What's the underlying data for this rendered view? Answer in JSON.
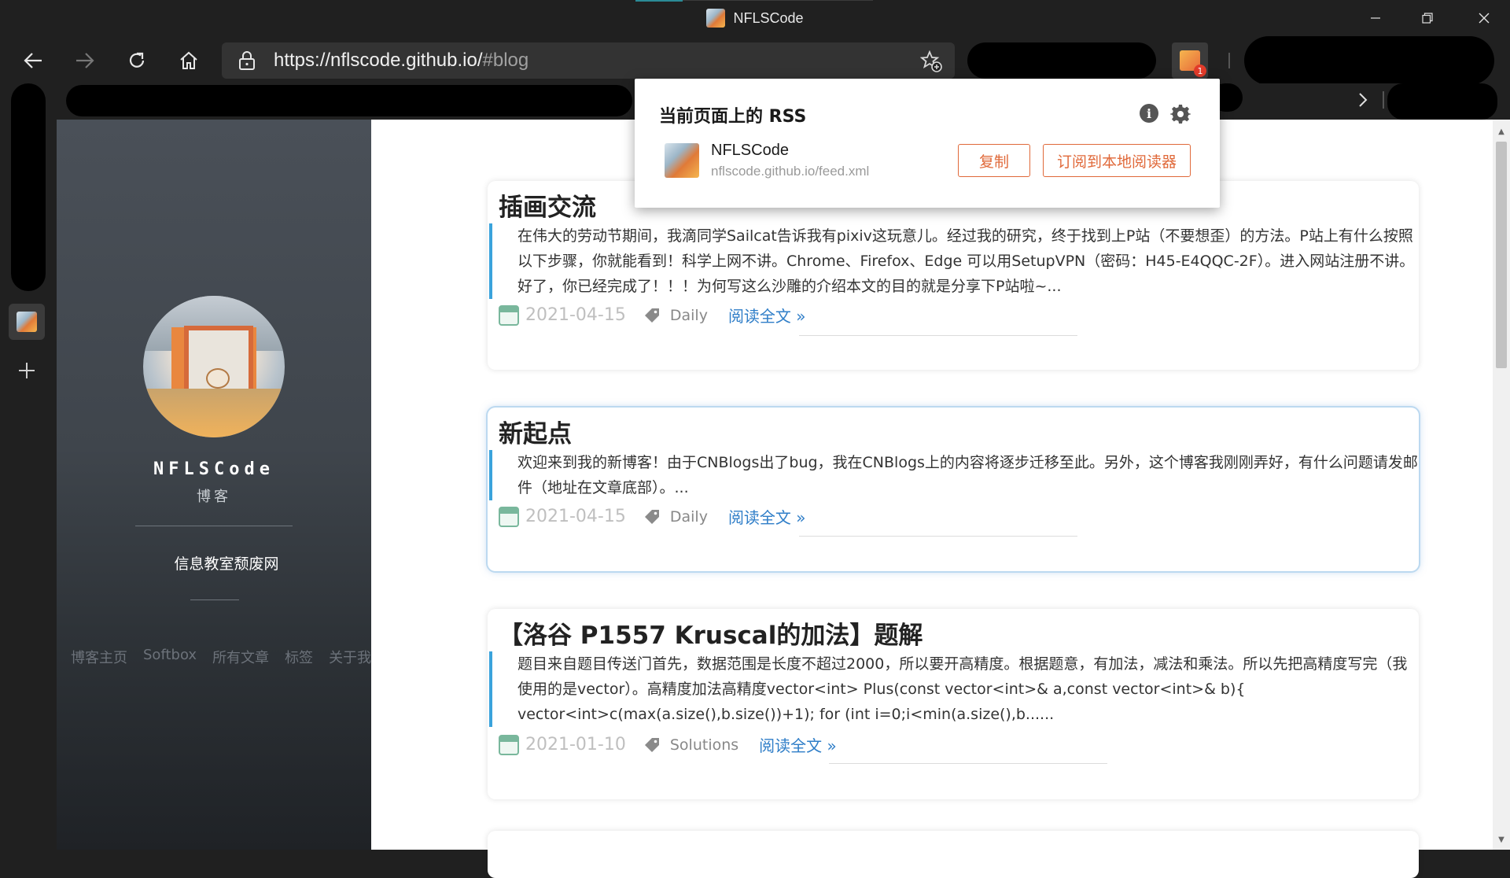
{
  "window": {
    "title": "NFLSCode",
    "minimize_icon": "minimize-icon",
    "maximize_icon": "restore-icon",
    "close_icon": "close-icon"
  },
  "toolbar": {
    "url_host": "https://nflscode.github.io/",
    "url_path": "#blog",
    "back_icon": "back-arrow-icon",
    "forward_icon": "forward-arrow-icon",
    "refresh_icon": "refresh-icon",
    "home_icon": "home-icon",
    "lock_icon": "lock-icon",
    "favorite_icon": "add-favorite-icon",
    "rss_badge": "1"
  },
  "favbar": {
    "chevron_icon": "chevron-right-icon"
  },
  "rss_popup": {
    "title": "当前页面上的 RSS",
    "feed_name": "NFLSCode",
    "feed_url": "nflscode.github.io/feed.xml",
    "copy_label": "复制",
    "subscribe_label": "订阅到本地阅读器"
  },
  "sidebar": {
    "blog_name": "NFLSCode",
    "subtitle": "博客",
    "link": "信息教室颓废网",
    "nav": [
      "博客主页",
      "Softbox",
      "所有文章",
      "标签",
      "关于我"
    ]
  },
  "posts": [
    {
      "title": "插画交流",
      "excerpt": "在伟大的劳动节期间，我滴同学Sailcat告诉我有pixiv这玩意儿。经过我的研究，终于找到上P站（不要想歪）的方法。P站上有什么按照以下步骤，你就能看到！科学上网不讲。Chrome、Firefox、Edge 可以用SetupVPN（密码：H45-E4QQC-2F）。进入网站注册不讲。好了，你已经完成了！！！为何写这么沙雕的介绍本文的目的就是分享下P站啦~...",
      "date": "2021-04-15",
      "tag": "Daily",
      "read_more": "阅读全文 »"
    },
    {
      "title": "新起点",
      "excerpt": "欢迎来到我的新博客！由于CNBlogs出了bug，我在CNBlogs上的内容将逐步迁移至此。另外，这个博客我刚刚弄好，有什么问题请发邮件（地址在文章底部）。...",
      "date": "2021-04-15",
      "tag": "Daily",
      "read_more": "阅读全文 »"
    },
    {
      "title": "【洛谷 P1557 Kruscal的加法】题解",
      "excerpt": "题目来自题目传送门首先，数据范围是长度不超过2000，所以要开高精度。根据题意，有加法，减法和乘法。所以先把高精度写完（我使用的是vector）。高精度加法高精度vector<int> Plus(const vector<int>& a,const vector<int>& b){ vector<int>c(max(a.size(),b.size())+1); for (int i=0;i<min(a.size(),b......",
      "date": "2021-01-10",
      "tag": "Solutions",
      "read_more": "阅读全文 »"
    }
  ],
  "colors": {
    "accent_blue": "#3aa3dc",
    "link_blue": "#2f7ec8",
    "rss_orange": "#e0693a",
    "chrome_dark": "#202020"
  }
}
